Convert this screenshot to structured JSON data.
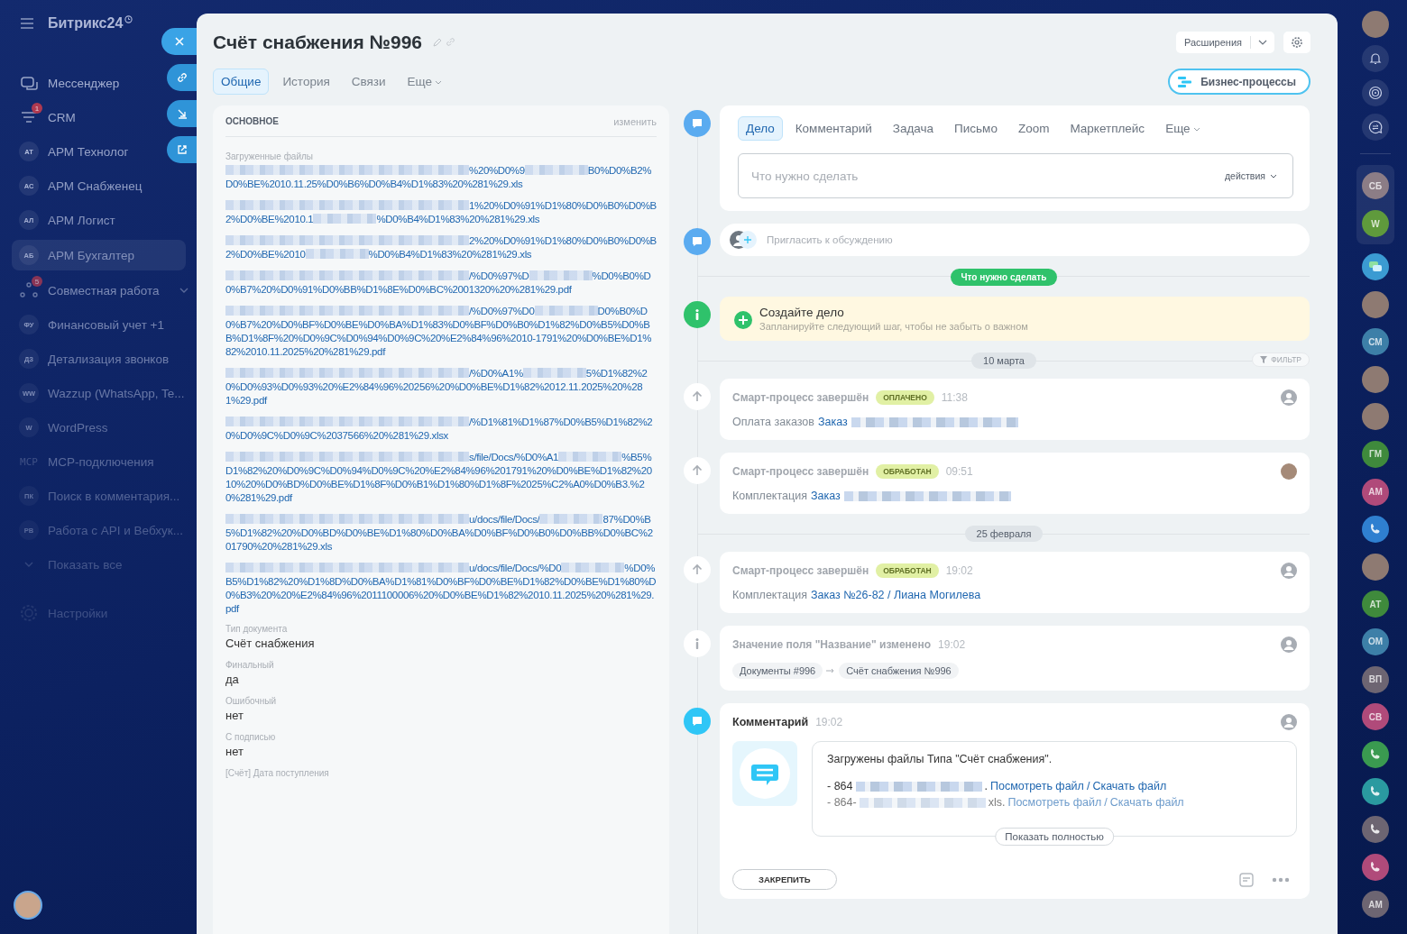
{
  "sidebar": {
    "logo": "Битрикс24",
    "items": [
      {
        "kind": "chat",
        "label": "Мессенджер",
        "selected": false
      },
      {
        "kind": "funnel",
        "label": "CRM",
        "badge": "1",
        "selected": false
      },
      {
        "kind": "initials",
        "initials": "АТ",
        "label": "АРМ Технолог",
        "selected": false
      },
      {
        "kind": "initials",
        "initials": "АС",
        "label": "АРМ Снабженец",
        "selected": false
      },
      {
        "kind": "initials",
        "initials": "АЛ",
        "label": "АРМ Логист",
        "selected": false
      },
      {
        "kind": "initials",
        "initials": "АБ",
        "label": "АРМ Бухгалтер",
        "selected": true
      },
      {
        "kind": "group",
        "label": "Совместная работа",
        "badge": "5",
        "selected": false
      },
      {
        "kind": "initials",
        "initials": "ФУ",
        "label": "Финансовый учет +1",
        "selected": false
      },
      {
        "kind": "initials",
        "initials": "ДЗ",
        "label": "Детализация звонков",
        "selected": false
      },
      {
        "kind": "initials",
        "initials": "WW",
        "label": "Wazzup (WhatsApp, Te...",
        "selected": false
      },
      {
        "kind": "initials",
        "initials": "W",
        "label": "WordPress",
        "selected": false
      },
      {
        "kind": "mcp",
        "initials": "MCP",
        "label": "MCP-подключения",
        "selected": false
      },
      {
        "kind": "initials",
        "initials": "ПК",
        "label": "Поиск в комментария...",
        "selected": false
      },
      {
        "kind": "initials",
        "initials": "РВ",
        "label": "Работа с API и Вебхук...",
        "selected": false
      },
      {
        "kind": "more",
        "label": "Показать все",
        "selected": false
      },
      {
        "kind": "settings",
        "label": "Настройки",
        "selected": false
      }
    ]
  },
  "header": {
    "title": "Счёт снабжения №996",
    "extensions": "Расширения",
    "bp_button": "Бизнес-процессы",
    "tabs": [
      {
        "label": "Общие",
        "selected": true,
        "menu": false
      },
      {
        "label": "История",
        "selected": false,
        "menu": false
      },
      {
        "label": "Связи",
        "selected": false,
        "menu": false
      },
      {
        "label": "Еще",
        "selected": false,
        "menu": true
      }
    ]
  },
  "details": {
    "title": "ОСНОВНОЕ",
    "edit": "изменить",
    "fields": [
      {
        "kind": "files",
        "label": "Загруженные файлы",
        "files": [
          {
            "segments": [
              "%20%D0%9",
              "B0%D0%B2%D0%BE%2010.11.25%D0%B6%D0%B4%D1%83%20%281%29.xls"
            ]
          },
          {
            "segments": [
              "1%20%D0%91%D1%80%D0%B0%D0%B2%D0%BE%2010.1",
              "%D0%B4%D1%83%20%281%29.xls"
            ]
          },
          {
            "segments": [
              "2%20%D0%91%D1%80%D0%B0%D0%B2%D0%BE%2010",
              "%D0%B4%D1%83%20%281%29.xls"
            ]
          },
          {
            "segments": [
              "/%D0%97%D",
              "%D0%B0%D0%B7%20%D0%91%D0%BB%D1%8E%D0%BC%2001320%20%281%29.pdf"
            ]
          },
          {
            "segments": [
              "/%D0%97%D0",
              "D0%B0%D0%B7%20%D0%BF%D0%BE%D0%BA%D1%83%D0%BF%D0%B0%D1%82%D0%B5%D0%BB%D1%8F%20%D0%9C%D0%94%D0%9C%20%E2%84%96%2010-1791%20%D0%BE%D1%82%2010.11.2025%20%281%29.pdf"
            ]
          },
          {
            "segments": [
              "/%D0%A1%",
              "5%D1%82%20%D0%93%D0%93%20%E2%84%96%20256%20%D0%BE%D1%82%2012.11.2025%20%281%29.pdf"
            ]
          },
          {
            "segments": [
              "/%D1%81%D1%87%D0%B5%D1%82%20%D0%9C%D0%9C%2037566%20%281%29.xlsx"
            ]
          },
          {
            "segments": [
              "s/file/Docs/%D0%A1",
              "%B5%D1%82%20%D0%9C%D0%94%D0%9C%20%E2%84%96%201791%20%D0%BE%D1%82%2010%20%D0%BD%D0%BE%D1%8F%D0%B1%D1%80%D1%8F%2025%C2%A0%D0%B3.%20%281%29.pdf"
            ]
          },
          {
            "segments": [
              "u/docs/file/Docs/",
              "87%D0%B5%D1%82%20%D0%BD%D0%BE%D1%80%D0%BA%D0%BF%D0%B0%D0%BB%D0%BC%201790%20%281%29.xls"
            ]
          },
          {
            "segments": [
              "u/docs/file/Docs/%D0",
              "%D0%B5%D1%82%20%D1%8D%D0%BA%D1%81%D0%BF%D0%BE%D1%82%D0%BE%D1%80%D0%B3%20%20%E2%84%96%2011100006%20%D0%BE%D1%82%2010.11.2025%20%281%29.pdf"
            ]
          }
        ]
      },
      {
        "kind": "text",
        "label": "Тип документа",
        "value": "Счёт снабжения"
      },
      {
        "kind": "text",
        "label": "Финальный",
        "value": "да"
      },
      {
        "kind": "text",
        "label": "Ошибочный",
        "value": "нет"
      },
      {
        "kind": "text",
        "label": "С подписью",
        "value": "нет"
      },
      {
        "kind": "text",
        "label": "[Счёт] Дата поступления"
      }
    ]
  },
  "composer": {
    "tabs": [
      {
        "label": "Дело",
        "selected": true,
        "menu": false
      },
      {
        "label": "Комментарий",
        "selected": false,
        "menu": false
      },
      {
        "label": "Задача",
        "selected": false,
        "menu": false
      },
      {
        "label": "Письмо",
        "selected": false,
        "menu": false
      },
      {
        "label": "Zoom",
        "selected": false,
        "menu": false
      },
      {
        "label": "Маркетплейс",
        "selected": false,
        "menu": false
      },
      {
        "label": "Еще",
        "selected": false,
        "menu": true
      }
    ],
    "placeholder": "Что нужно сделать",
    "actions": "действия"
  },
  "invite": {
    "placeholder": "Пригласить к обсуждению"
  },
  "todo_divider": "Что нужно сделать",
  "create_hint": {
    "title": "Создайте дело",
    "subtitle": "Запланируйте следующий шаг, чтобы не забыть о важном"
  },
  "history": [
    {
      "kind": "date",
      "label": "10 марта",
      "filter": "ФИЛЬТР"
    },
    {
      "kind": "smart",
      "title": "Смарт-процесс завершён",
      "status": "ОПЛАЧЕНО",
      "time": "11:38",
      "text": "Оплата заказов",
      "link": "Заказ",
      "redacted": true,
      "author_photo": false
    },
    {
      "kind": "smart",
      "title": "Смарт-процесс завершён",
      "status": "ОБРАБОТАН",
      "time": "09:51",
      "text": "Комплектация",
      "link": "Заказ",
      "redacted": true,
      "author_photo": true
    },
    {
      "kind": "date",
      "label": "25 февраля"
    },
    {
      "kind": "smart",
      "title": "Смарт-процесс завершён",
      "status": "ОБРАБОТАН",
      "time": "19:02",
      "text": "Комплектация",
      "link": "Заказ №26-82 / Лиана Могилева",
      "redacted": false,
      "author_photo": false
    },
    {
      "kind": "field_change",
      "title": "Значение поля \"Название\" изменено",
      "time": "19:02",
      "from": "Документы #996",
      "to": "Счёт снабжения №996",
      "author_photo": false
    },
    {
      "kind": "comment",
      "title": "Комментарий",
      "time": "19:02",
      "author_photo": false,
      "text": "Загружены файлы Типа \"Счёт снабжения\".",
      "files": [
        {
          "prefix": "- 864",
          "suffix": ".",
          "view": "Посмотреть файл",
          "separator": "/",
          "download": "Скачать файл"
        },
        {
          "prefix": "- 864-",
          "suffix": "xls.",
          "view": "Посмотреть файл",
          "separator": "/",
          "download": "Скачать файл"
        }
      ],
      "expand": "Показать полностью",
      "pin": "ЗАКРЕПИТЬ"
    }
  ],
  "right_bar": {
    "top": [
      {
        "kind": "photo"
      },
      {
        "kind": "bell"
      },
      {
        "kind": "target"
      },
      {
        "kind": "exchange"
      }
    ],
    "pinned": [
      {
        "kind": "initials",
        "initials": "СБ",
        "color": "#8c7d86"
      },
      {
        "kind": "initials",
        "initials": "W",
        "color": "#5f9a3c"
      }
    ],
    "items": [
      {
        "kind": "chat",
        "color": "#3b9bd2"
      },
      {
        "kind": "photo"
      },
      {
        "kind": "initials",
        "initials": "СМ",
        "color": "#3d7fa8"
      },
      {
        "kind": "photo"
      },
      {
        "kind": "photo"
      },
      {
        "kind": "initials",
        "initials": "ГМ",
        "color": "#3f8a3c"
      },
      {
        "kind": "initials",
        "initials": "АМ",
        "color": "#b04a7a"
      },
      {
        "kind": "phone",
        "color": "#2f7fd0"
      },
      {
        "kind": "photo"
      },
      {
        "kind": "initials",
        "initials": "АТ",
        "color": "#3f8a3c"
      },
      {
        "kind": "initials",
        "initials": "ОМ",
        "color": "#3d7fa8"
      },
      {
        "kind": "initials",
        "initials": "ВП",
        "color": "#6d6572"
      },
      {
        "kind": "initials",
        "initials": "СВ",
        "color": "#b04a7a"
      },
      {
        "kind": "phone",
        "color": "#3a9a50"
      },
      {
        "kind": "phone",
        "color": "#2a9aa0"
      },
      {
        "kind": "phone",
        "color": "#6d6572"
      },
      {
        "kind": "phone",
        "color": "#b04a7a"
      },
      {
        "kind": "initials",
        "initials": "АМ",
        "color": "#6d6572"
      }
    ]
  }
}
